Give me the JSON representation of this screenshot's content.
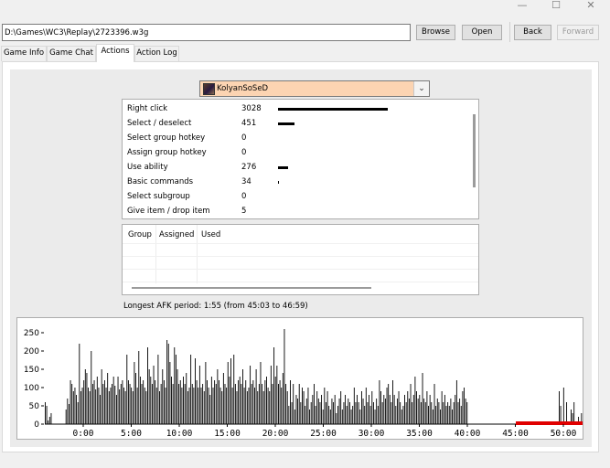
{
  "window": {
    "minimize_icon": "minimize-icon",
    "maximize_icon": "maximize-icon",
    "close_icon": "close-icon"
  },
  "toolbar": {
    "path_value": "D:\\Games\\WC3\\Replay\\2723396.w3g",
    "browse_label": "Browse",
    "open_label": "Open",
    "back_label": "Back",
    "forward_label": "Forward"
  },
  "tabs": [
    {
      "label": "Game Info",
      "active": false
    },
    {
      "label": "Game Chat",
      "active": false
    },
    {
      "label": "Actions",
      "active": true
    },
    {
      "label": "Action Log",
      "active": false
    }
  ],
  "player": {
    "name": "KolyanSoSeD",
    "avatar_icon": "player-avatar-icon",
    "highlight_color": "#fcd4b2"
  },
  "actions": [
    {
      "label": "Right click",
      "count": "3028"
    },
    {
      "label": "Select / deselect",
      "count": "451"
    },
    {
      "label": "Select group hotkey",
      "count": "0"
    },
    {
      "label": "Assign group hotkey",
      "count": "0"
    },
    {
      "label": "Use ability",
      "count": "276"
    },
    {
      "label": "Basic commands",
      "count": "34"
    },
    {
      "label": "Select subgroup",
      "count": "0"
    },
    {
      "label": "Give item / drop item",
      "count": "5"
    }
  ],
  "groups_table": {
    "headers": [
      "Group",
      "Assigned",
      "Used"
    ]
  },
  "afk_text": "Longest AFK period: 1:55 (from 45:03 to 46:59)",
  "chart_data": {
    "type": "bar",
    "title": "",
    "xlabel": "",
    "ylabel": "",
    "ylim": [
      0,
      270
    ],
    "xlim_minutes": [
      -4,
      52
    ],
    "y_ticks": [
      "250",
      "200",
      "150",
      "100",
      "50",
      "0"
    ],
    "x_ticks": [
      "0:00",
      "5:00",
      "10:00",
      "15:00",
      "20:00",
      "25:00",
      "30:00",
      "35:00",
      "40:00",
      "45:00",
      "50:00"
    ],
    "bar_color": "#000000",
    "afk_color": "#e00000",
    "afk_interval_minutes": [
      45.05,
      50.0
    ],
    "values": [
      60,
      50,
      10,
      20,
      30,
      0,
      0,
      0,
      0,
      0,
      0,
      0,
      0,
      0,
      40,
      70,
      55,
      120,
      110,
      90,
      100,
      80,
      60,
      220,
      90,
      100,
      120,
      150,
      140,
      100,
      90,
      200,
      110,
      120,
      95,
      130,
      100,
      80,
      150,
      110,
      120,
      100,
      140,
      90,
      100,
      110,
      130,
      105,
      80,
      130,
      95,
      110,
      120,
      100,
      90,
      190,
      120,
      110,
      100,
      90,
      170,
      140,
      100,
      200,
      130,
      110,
      120,
      100,
      90,
      210,
      150,
      130,
      110,
      160,
      120,
      100,
      190,
      90,
      110,
      150,
      120,
      100,
      230,
      220,
      170,
      130,
      110,
      210,
      190,
      150,
      110,
      120,
      100,
      130,
      110,
      140,
      90,
      100,
      190,
      110,
      100,
      180,
      120,
      100,
      160,
      100,
      110,
      90,
      170,
      120,
      100,
      80,
      130,
      100,
      120,
      110,
      150,
      120,
      100,
      90,
      140,
      110,
      100,
      170,
      130,
      180,
      100,
      190,
      110,
      90,
      120,
      130,
      110,
      150,
      100,
      120,
      90,
      100,
      160,
      110,
      120,
      100,
      150,
      90,
      110,
      170,
      110,
      90,
      120,
      130,
      100,
      90,
      160,
      110,
      210,
      130,
      160,
      110,
      120,
      100,
      140,
      260,
      110,
      90,
      50,
      120,
      60,
      110,
      40,
      80,
      70,
      110,
      60,
      100,
      90,
      50,
      70,
      100,
      40,
      60,
      80,
      110,
      50,
      90,
      70,
      60,
      80,
      40,
      100,
      60,
      90,
      50,
      40,
      70,
      60,
      80,
      30,
      50,
      70,
      90,
      40,
      60,
      80,
      50,
      70,
      60,
      40,
      50,
      100,
      60,
      80,
      60,
      40,
      90,
      70,
      50,
      100,
      60,
      80,
      50,
      90,
      60,
      40,
      70,
      50,
      120,
      90,
      60,
      80,
      70,
      100,
      110,
      80,
      60,
      120,
      80,
      50,
      70,
      90,
      60,
      40,
      50,
      80,
      60,
      90,
      70,
      110,
      60,
      80,
      130,
      90,
      70,
      80,
      60,
      140,
      70,
      60,
      90,
      50,
      80,
      60,
      40,
      110,
      50,
      70,
      60,
      40,
      90,
      60,
      80,
      50,
      60,
      50,
      70,
      40,
      60,
      80,
      120,
      60,
      70,
      50,
      90,
      100,
      70,
      60,
      0,
      0,
      0,
      0,
      0,
      0,
      0,
      0,
      0,
      0,
      0,
      0,
      0,
      0,
      0,
      0,
      0,
      0,
      0,
      0,
      0,
      0,
      0,
      0,
      0,
      0,
      0,
      0,
      0,
      0,
      0,
      0,
      0,
      0,
      0,
      0,
      0,
      0,
      0,
      0,
      0,
      0,
      0,
      0,
      0,
      0,
      0,
      0,
      0,
      0,
      0,
      0,
      0,
      0,
      0,
      0,
      0,
      0,
      0,
      0,
      0,
      90,
      50,
      0,
      100,
      0,
      60,
      0,
      0,
      40,
      30,
      60,
      0,
      0,
      20,
      0,
      30
    ]
  }
}
